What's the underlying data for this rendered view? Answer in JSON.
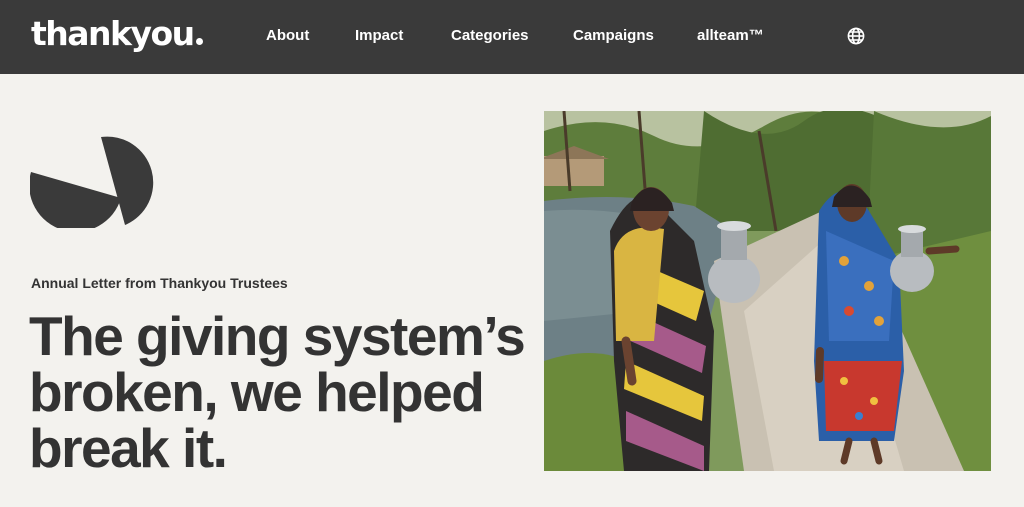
{
  "header": {
    "logo_text": "thankyou",
    "nav": [
      {
        "label": "About"
      },
      {
        "label": "Impact"
      },
      {
        "label": "Categories"
      },
      {
        "label": "Campaigns"
      },
      {
        "label": "allteam™"
      }
    ],
    "globe_icon": "globe-icon"
  },
  "hero": {
    "emblem_icon": "thankyou-emblem-icon",
    "eyebrow": "Annual Letter from Thankyou Trustees",
    "headline_lines": [
      "The giving system’s",
      "broken, we helped",
      "break it."
    ]
  },
  "colors": {
    "header_bg": "#3a3a3a",
    "page_bg": "#f3f2ee",
    "text": "#333333"
  }
}
